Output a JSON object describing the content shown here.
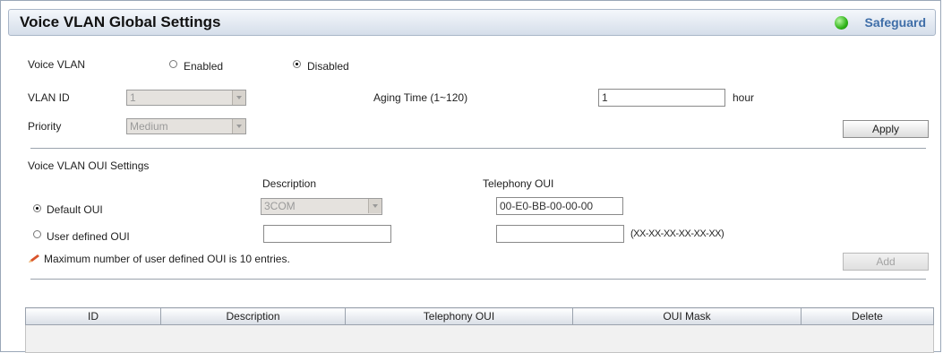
{
  "header": {
    "title": "Voice VLAN Global Settings",
    "safeguard": "Safeguard"
  },
  "global": {
    "voice_vlan_label": "Voice VLAN",
    "enabled_label": "Enabled",
    "disabled_label": "Disabled",
    "voice_vlan_selected": "Disabled",
    "vlan_id_label": "VLAN ID",
    "vlan_id_value": "1",
    "priority_label": "Priority",
    "priority_value": "Medium",
    "aging_time_label": "Aging Time (1~120)",
    "aging_time_value": "1",
    "aging_time_unit": "hour",
    "apply_label": "Apply"
  },
  "oui": {
    "section_title": "Voice VLAN OUI Settings",
    "description_header": "Description",
    "telephony_header": "Telephony OUI",
    "default_oui_label": "Default OUI",
    "default_description": "3COM",
    "default_telephony": "00-E0-BB-00-00-00",
    "user_defined_label": "User defined OUI",
    "user_description": "",
    "user_telephony": "",
    "format_hint": "(XX-XX-XX-XX-XX-XX)",
    "selected": "Default OUI",
    "note": "Maximum number of user defined OUI is 10 entries.",
    "add_label": "Add"
  },
  "table": {
    "columns": [
      "ID",
      "Description",
      "Telephony OUI",
      "OUI Mask",
      "Delete"
    ]
  }
}
